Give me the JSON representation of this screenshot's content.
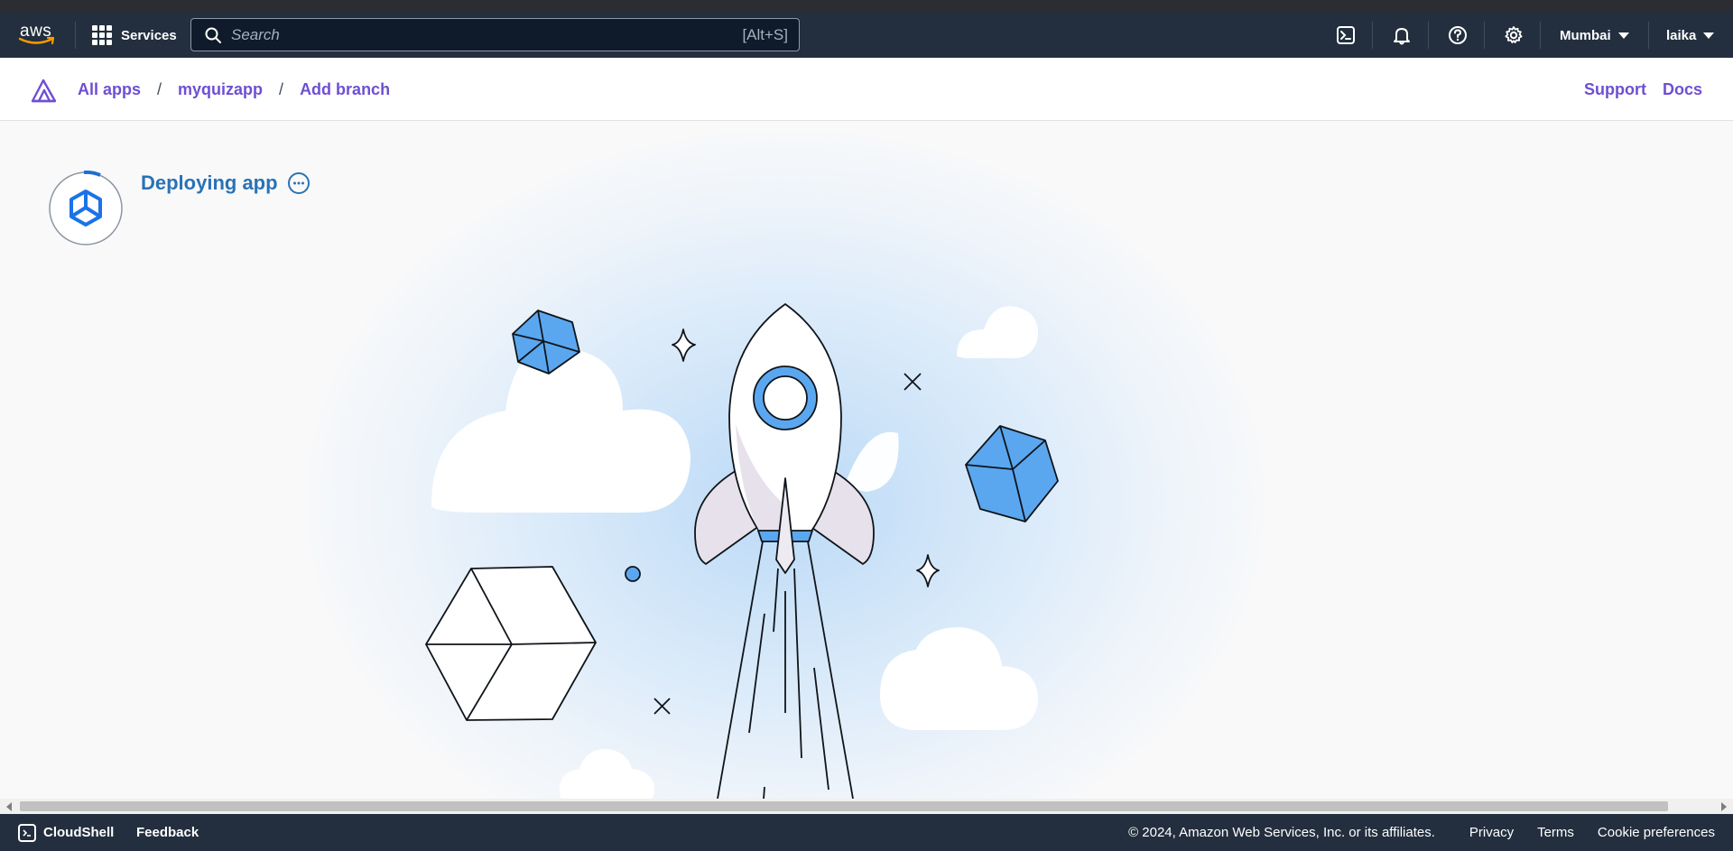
{
  "header": {
    "logo_text": "aws",
    "services_label": "Services",
    "search_placeholder": "Search",
    "search_shortcut": "[Alt+S]",
    "region": "Mumbai",
    "user": "laika"
  },
  "breadcrumb": {
    "items": [
      "All apps",
      "myquizapp",
      "Add branch"
    ],
    "separator": "/",
    "support": "Support",
    "docs": "Docs"
  },
  "status": {
    "title": "Deploying app"
  },
  "footer": {
    "cloudshell": "CloudShell",
    "feedback": "Feedback",
    "copyright": "© 2024, Amazon Web Services, Inc. or its affiliates.",
    "privacy": "Privacy",
    "terms": "Terms",
    "cookies": "Cookie preferences"
  },
  "colors": {
    "header_bg": "#232f3e",
    "accent_purple": "#6e4fd3",
    "status_blue": "#2a72b5",
    "illustration_blue": "#5aa7f0"
  }
}
